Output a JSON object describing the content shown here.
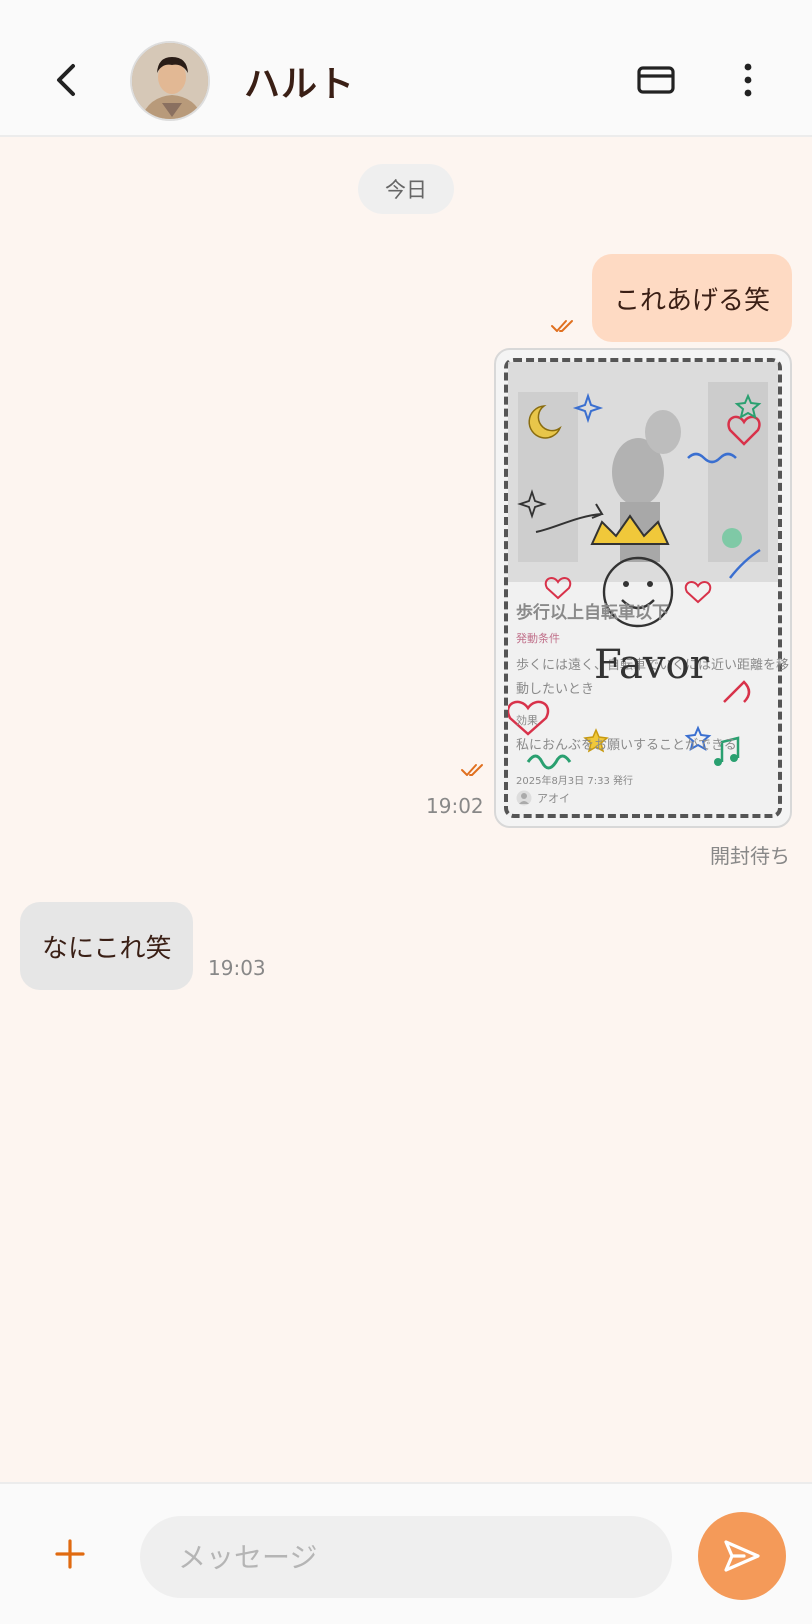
{
  "header": {
    "contact_name": "ハルト",
    "back_icon": "chevron-left-icon",
    "card_icon": "card-icon",
    "more_icon": "more-vertical-icon"
  },
  "chat": {
    "date_divider": "今日",
    "messages": [
      {
        "direction": "out",
        "text": "これあげる笑",
        "read": true
      },
      {
        "direction": "out",
        "type": "favor-card",
        "time": "19:02",
        "read": true,
        "status": "開封待ち",
        "card": {
          "title": "歩行以上自転車以下",
          "condition_label": "発動条件",
          "condition_text_1": "歩くには遠く、自転車でいくには近い距離を移",
          "condition_text_2": "動したいとき",
          "ability_label": "効果",
          "ability_text": "私におんぶをお願いすることができる",
          "date": "2025年8月3日 7:33 発行",
          "author": "アオイ",
          "logo_text": "Favor"
        }
      },
      {
        "direction": "in",
        "text": "なにこれ笑",
        "time": "19:03"
      }
    ]
  },
  "composer": {
    "placeholder": "メッセージ",
    "value": "",
    "add_icon": "plus-icon",
    "send_icon": "send-icon"
  },
  "colors": {
    "accent": "#e06a10",
    "send_button": "#f49a59",
    "outgoing_bubble": "#fedac3",
    "incoming_bubble": "#e6e6e6",
    "background": "#fdf5f0"
  }
}
